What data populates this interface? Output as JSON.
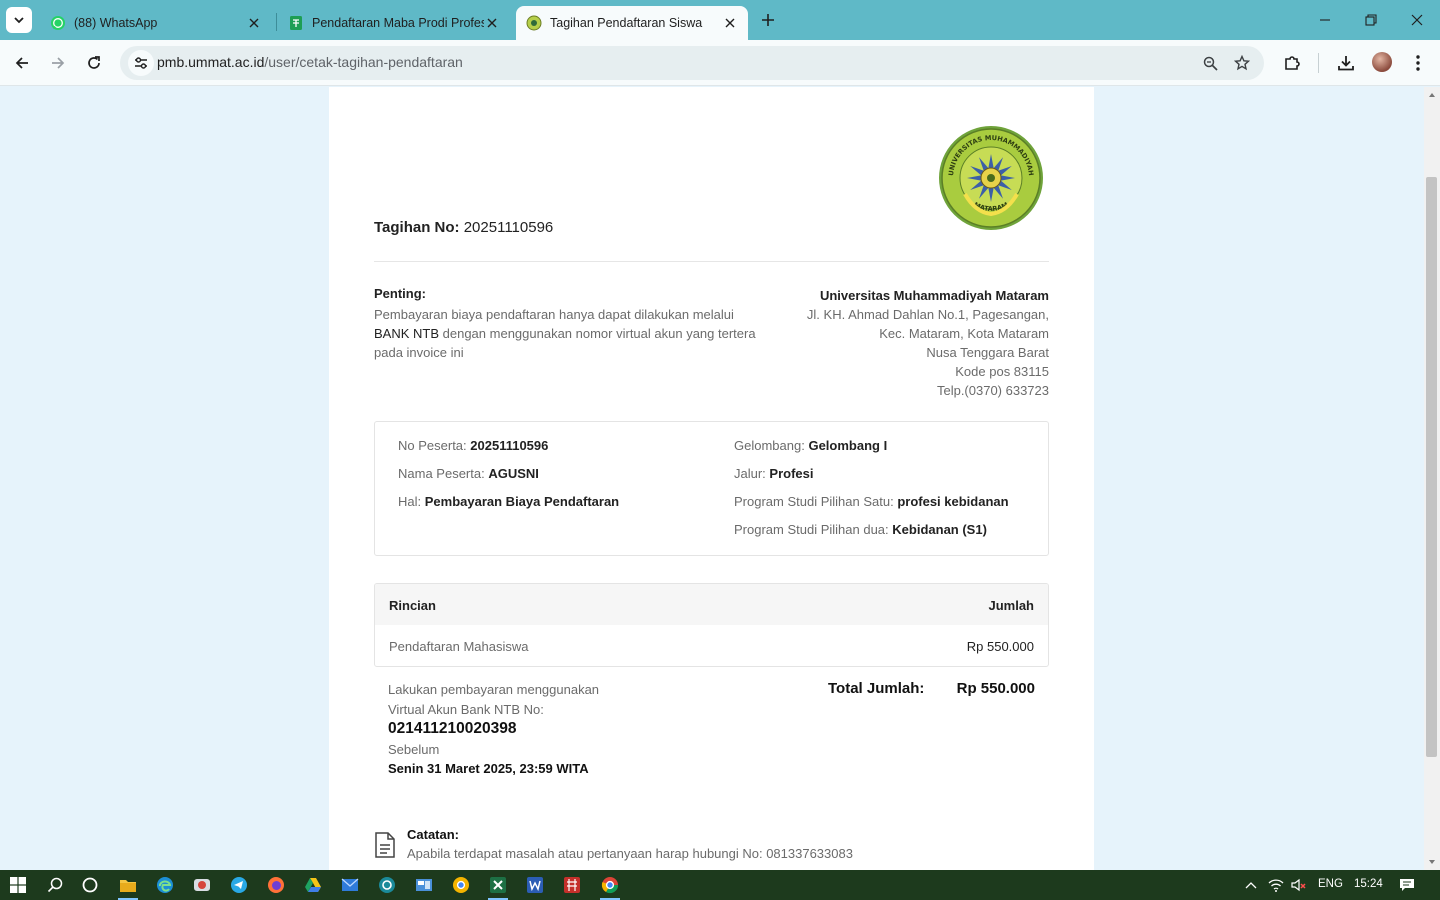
{
  "browser": {
    "tabs": [
      {
        "title": "(88) WhatsApp",
        "icon": "whatsapp-icon",
        "active": false
      },
      {
        "title": "Pendaftaran Maba Prodi Profesi",
        "icon": "sheets-icon",
        "active": false
      },
      {
        "title": "Tagihan Pendaftaran Siswa",
        "icon": "ummat-icon",
        "active": true
      }
    ],
    "url_domain": "pmb.ummat.ac.id",
    "url_path": "/user/cetak-tagihan-pendaftaran",
    "accent": "#5fb9c7"
  },
  "invoice": {
    "number_label": "Tagihan No:",
    "number": "20251110596",
    "note_title": "Penting:",
    "note_part1": "Pembayaran biaya pendaftaran hanya dapat dilakukan melalui",
    "note_bank": "BANK NTB",
    "note_part2": "dengan menggunakan nomor virtual akun yang tertera pada invoice ini",
    "university": "Universitas Muhammadiyah Mataram",
    "address": [
      "Jl. KH. Ahmad Dahlan No.1, Pagesangan,",
      "Kec. Mataram, Kota Mataram",
      "Nusa Tenggara Barat",
      "Kode pos 83115",
      "Telp.(0370) 633723"
    ],
    "details": {
      "no_peserta_label": "No Peserta:",
      "no_peserta": "20251110596",
      "nama_label": "Nama Peserta:",
      "nama": "AGUSNI",
      "hal_label": "Hal:",
      "hal": "Pembayaran Biaya Pendaftaran",
      "gelombang_label": "Gelombang:",
      "gelombang": "Gelombang I",
      "jalur_label": "Jalur:",
      "jalur": "Profesi",
      "prodi1_label": "Program Studi Pilihan Satu:",
      "prodi1": "profesi kebidanan",
      "prodi2_label": "Program Studi Pilihan dua:",
      "prodi2": "Kebidanan (S1)"
    },
    "table": {
      "headers": [
        "Rincian",
        "Jumlah"
      ],
      "rows": [
        {
          "item": "Pendaftaran Mahasiswa",
          "amount": "Rp 550.000"
        }
      ]
    },
    "payment": {
      "line1": "Lakukan pembayaran menggunakan",
      "line2": "Virtual Akun Bank NTB No:",
      "va_number": "021411210020398",
      "before_label": "Sebelum",
      "deadline": "Senin 31 Maret 2025, 23:59 WITA"
    },
    "total_label": "Total Jumlah:",
    "total_value": "Rp 550.000",
    "catatan_title": "Catatan:",
    "catatan_text": "Apabila terdapat masalah atau pertanyaan harap hubungi No: 081337633083",
    "logo_ring_text_top": "UNIVERSITAS MUHAMMADIYAH",
    "logo_ring_text_bottom": "MATARAM"
  },
  "taskbar": {
    "language": "ENG",
    "time": "15:24"
  }
}
